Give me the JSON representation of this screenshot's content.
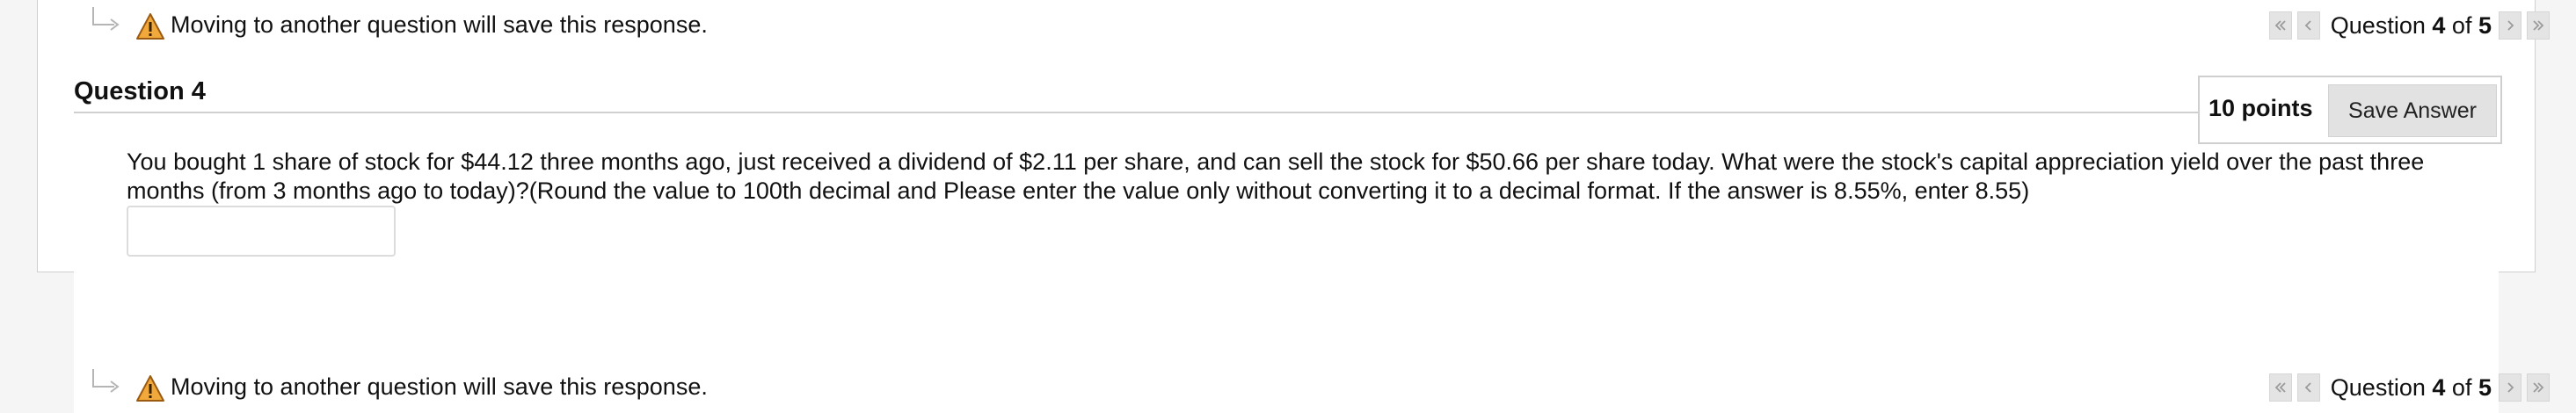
{
  "top_nav": {
    "warning_text": "Moving to another question will save this response.",
    "question_label": "Question",
    "current": "4",
    "of_label": "of",
    "total": "5"
  },
  "question": {
    "title": "Question 4",
    "points": "10 points",
    "save_label": "Save Answer",
    "text": "You bought 1 share of stock for $44.12 three months ago, just received a dividend of $2.11 per share, and can sell the stock for $50.66 per share today. What were the stock's capital appreciation yield over the past three months (from 3 months ago to today)?(Round the value to 100th decimal and Please enter the value only without converting it to a decimal format. If the answer is 8.55%, enter 8.55)",
    "answer_value": ""
  },
  "bottom_nav": {
    "warning_text": "Moving to another question will save this response.",
    "question_label": "Question",
    "current": "4",
    "of_label": "of",
    "total": "5"
  },
  "icons": {
    "warning": "warning-triangle-icon",
    "arrow": "indent-arrow-icon",
    "first": "double-chevron-left-icon",
    "prev": "chevron-left-icon",
    "next": "chevron-right-icon",
    "last": "double-chevron-right-icon"
  },
  "colors": {
    "warning_fill": "#f2a93b",
    "button_bg": "#e2e2e2",
    "border": "#cfcfcf"
  }
}
